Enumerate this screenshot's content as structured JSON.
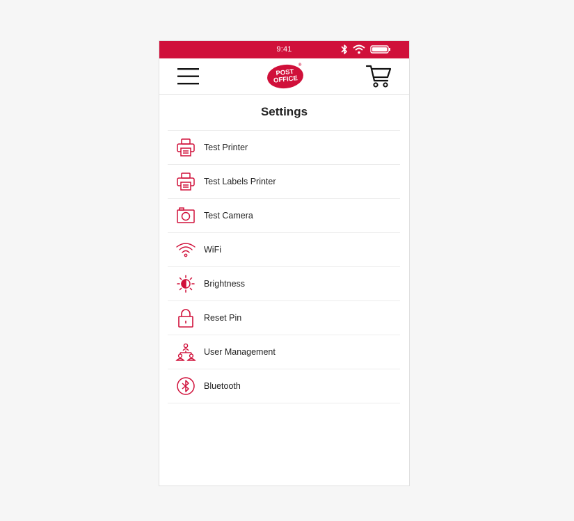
{
  "status_bar": {
    "time": "9:41"
  },
  "header": {
    "logo_line1": "POST",
    "logo_line2": "OFFICE",
    "logo_reg": "®"
  },
  "page": {
    "title": "Settings"
  },
  "settings": {
    "items": [
      {
        "label": "Test Printer",
        "icon": "printer-icon"
      },
      {
        "label": "Test Labels Printer",
        "icon": "printer-icon"
      },
      {
        "label": "Test Camera",
        "icon": "camera-icon"
      },
      {
        "label": "WiFi",
        "icon": "wifi-icon"
      },
      {
        "label": "Brightness",
        "icon": "brightness-icon"
      },
      {
        "label": "Reset Pin",
        "icon": "lock-icon"
      },
      {
        "label": "User Management",
        "icon": "users-icon"
      },
      {
        "label": "Bluetooth",
        "icon": "bluetooth-icon"
      }
    ]
  },
  "colors": {
    "brand": "#d0103a",
    "text": "#222222",
    "divider": "#ececec"
  }
}
